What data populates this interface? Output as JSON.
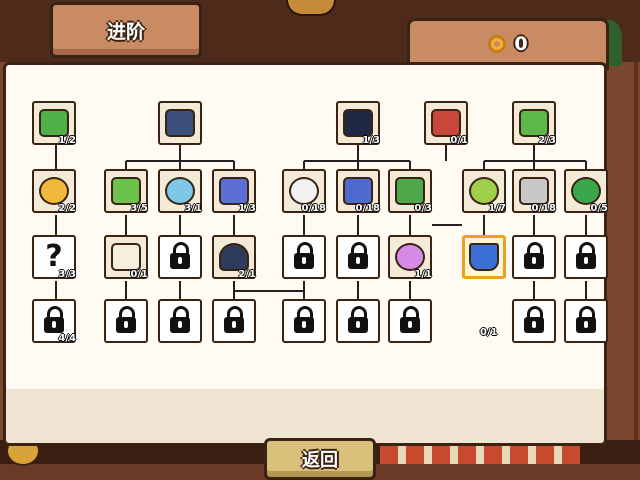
{
  "header": {
    "title": "进阶"
  },
  "currency": {
    "icon": "gear-icon",
    "value": "0"
  },
  "footer": {
    "back_label": "返回"
  },
  "colors": {
    "selected_border": "#f0a020",
    "panel_bg": "#fffaf2",
    "frame": "#3a2313"
  },
  "tree": {
    "nodes": [
      {
        "id": "n-a1",
        "state": "unlocked",
        "icon": "clover-recipe-icon",
        "count": "1/2"
      },
      {
        "id": "n-a2",
        "state": "unlocked",
        "icon": "clover-fruit-icon",
        "count": "2/2"
      },
      {
        "id": "n-a3",
        "state": "unlocked",
        "icon": "question-mark-icon",
        "count": "3/3"
      },
      {
        "id": "n-a4",
        "state": "locked",
        "icon": "lock-icon",
        "count": "4/4"
      },
      {
        "id": "n-b0",
        "state": "unlocked",
        "icon": "robot-chef-icon",
        "count": ""
      },
      {
        "id": "n-b1",
        "state": "unlocked",
        "icon": "clover-lightning-icon",
        "count": "3/5"
      },
      {
        "id": "n-b2",
        "state": "unlocked",
        "icon": "fan-icon",
        "count": "3/1"
      },
      {
        "id": "n-b3",
        "state": "unlocked",
        "icon": "sparkle-card-icon",
        "count": "1/3"
      },
      {
        "id": "n-b4",
        "state": "unlocked",
        "icon": "lucky-cat-icon",
        "count": "0/1"
      },
      {
        "id": "n-b5",
        "state": "locked",
        "icon": "lock-icon",
        "count": ""
      },
      {
        "id": "n-b6",
        "state": "unlocked",
        "icon": "rice-ball-robot-icon",
        "count": "2/1"
      },
      {
        "id": "n-b7",
        "state": "locked",
        "icon": "lock-icon",
        "count": ""
      },
      {
        "id": "n-b8",
        "state": "locked",
        "icon": "lock-icon",
        "count": ""
      },
      {
        "id": "n-b9",
        "state": "locked",
        "icon": "lock-icon",
        "count": ""
      },
      {
        "id": "n-c0",
        "state": "unlocked",
        "icon": "chef-hat-robot-icon",
        "count": "1/3"
      },
      {
        "id": "n-c1",
        "state": "unlocked",
        "icon": "egg-sparkle-icon",
        "count": "0/18"
      },
      {
        "id": "n-c2",
        "state": "unlocked",
        "icon": "blue-card-icon",
        "count": "0/18"
      },
      {
        "id": "n-c3",
        "state": "unlocked",
        "icon": "mystery-box-icon",
        "count": "0/3"
      },
      {
        "id": "n-c4",
        "state": "locked",
        "icon": "lock-icon",
        "count": ""
      },
      {
        "id": "n-c5",
        "state": "locked",
        "icon": "lock-icon",
        "count": ""
      },
      {
        "id": "n-c6",
        "state": "unlocked",
        "icon": "star-wand-icon",
        "count": "1/1"
      },
      {
        "id": "n-c7",
        "state": "locked",
        "icon": "lock-icon",
        "count": ""
      },
      {
        "id": "n-c8",
        "state": "locked",
        "icon": "lock-icon",
        "count": ""
      },
      {
        "id": "n-c9",
        "state": "locked",
        "icon": "lock-icon",
        "count": ""
      },
      {
        "id": "n-d0",
        "state": "unlocked",
        "icon": "shop-stall-icon",
        "count": "0/1"
      },
      {
        "id": "n-d1",
        "state": "unlocked",
        "icon": "money-clover-icon",
        "count": "2/3"
      },
      {
        "id": "n-d2",
        "state": "unlocked",
        "icon": "clover-coin-icon",
        "count": "1/7"
      },
      {
        "id": "n-d3",
        "state": "unlocked",
        "icon": "coin-stack-icon",
        "count": "0/18"
      },
      {
        "id": "n-d4",
        "state": "unlocked",
        "icon": "refresh-icon",
        "count": "0/5"
      },
      {
        "id": "n-d5",
        "state": "selected",
        "icon": "basket-icon",
        "count": ""
      },
      {
        "id": "n-d6",
        "state": "locked",
        "icon": "lock-icon",
        "count": ""
      },
      {
        "id": "n-d7",
        "state": "locked",
        "icon": "lock-icon",
        "count": ""
      },
      {
        "id": "n-d8",
        "state": "locked",
        "icon": "lock-icon",
        "count": ""
      },
      {
        "id": "n-d9",
        "state": "locked",
        "icon": "lock-icon",
        "count": ""
      }
    ],
    "floating_count": "0/1"
  }
}
